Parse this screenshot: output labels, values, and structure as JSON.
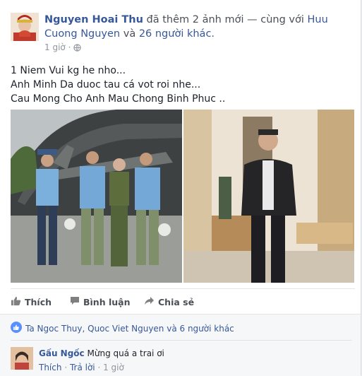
{
  "post": {
    "author": "Nguyen Hoai Thu",
    "action_text": "đã thêm 2 ảnh mới — cùng với",
    "tagged_person": "Huu Cuong Nguyen",
    "and_text": "và",
    "others_link": "26 người khác.",
    "time": "1 giờ",
    "audience_icon": "globe-icon",
    "text_lines": [
      "1 Niem Vui kg he nho...",
      "Anh Minh Da duoc tau cá vot roi nhe...",
      "Cau Mong Cho Anh Mau Chong Binh Phuc .."
    ]
  },
  "actions": {
    "like": "Thích",
    "comment": "Bình luận",
    "share": "Chia sẻ"
  },
  "likes": {
    "text": "Ta Ngoc Thuy, Quoc Viet Nguyen và 6 người khác"
  },
  "comment": {
    "author": "Gấu Ngốc",
    "text": "Mừng quá a trai ơi",
    "like": "Thích",
    "reply": "Trả lời",
    "time": "1 giờ"
  },
  "colors": {
    "link": "#365899",
    "meta": "#90949c",
    "ufi_bg": "#f6f7f9"
  }
}
